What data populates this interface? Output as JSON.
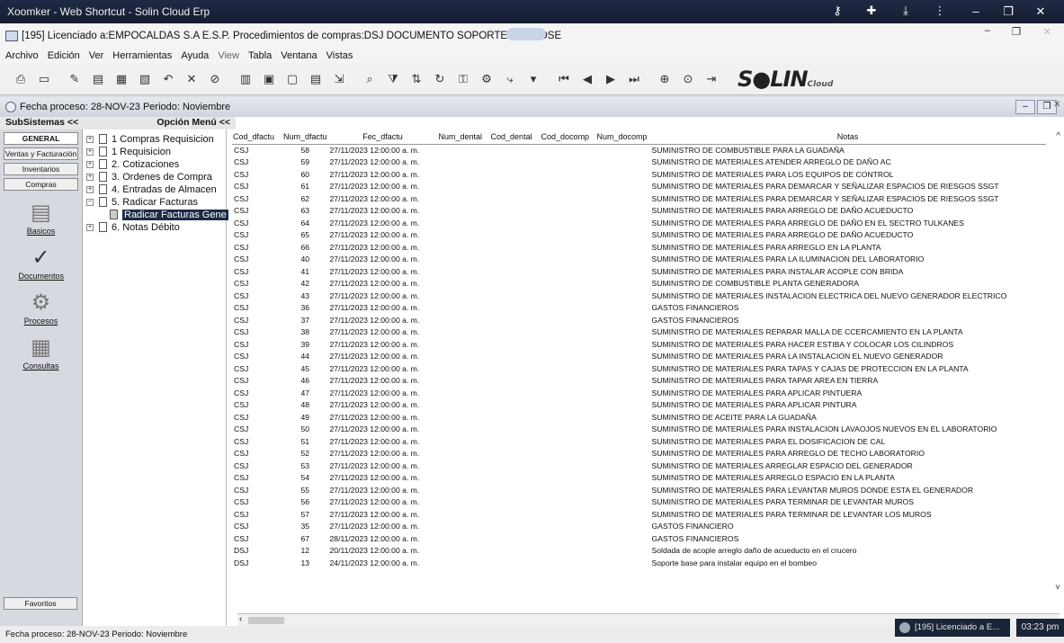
{
  "window": {
    "title": "Xoomker - Web Shortcut - Solin Cloud Erp",
    "doc_title": "[195] Licenciado a:EMPOCALDAS S.A E.S.P. Procedimientos de compras:DSJ DOCUMENTO SOPORTE SAN JOSE"
  },
  "menu": [
    "Archivo",
    "Edición",
    "Ver",
    "Herramientas",
    "Ayuda",
    "View",
    "Tabla",
    "Ventana",
    "Vistas"
  ],
  "logo": {
    "text": "S●LIN",
    "sub": "Cloud"
  },
  "inner": {
    "header": "Fecha proceso: 28-NOV-23 Periodo: Noviembre",
    "subsistemas": "SubSistemas <<",
    "opcion_menu": "Opción Menú <<"
  },
  "modules": {
    "buttons": [
      "GENERAL",
      "Ventas y Facturación",
      "Inventarios",
      "Compras"
    ],
    "icons": [
      "Basicos",
      "Documentos",
      "Procesos",
      "Consultas"
    ],
    "favoritos": "Favoritos"
  },
  "tree": [
    {
      "label": "1 Compras Requisicion"
    },
    {
      "label": "1 Requisicion"
    },
    {
      "label": "2. Cotizaciones"
    },
    {
      "label": "3. Ordenes de Compra"
    },
    {
      "label": "4. Entradas de Almacen"
    },
    {
      "label": "5. Radicar Facturas"
    },
    {
      "label": "Radicar Facturas Gene"
    },
    {
      "label": "6. Notas Débito"
    }
  ],
  "grid": {
    "columns": [
      "Cod_dfactu",
      "Num_dfactu",
      "Fec_dfactu",
      "Num_dental",
      "Cod_dental",
      "Cod_docomp",
      "Num_docomp",
      "Notas"
    ],
    "rows": [
      [
        "CSJ",
        "58",
        "27/11/2023 12:00:00 a. m.",
        "SUMINISTRO DE COMBUSTIBLE PARA LA GUADAÑA"
      ],
      [
        "CSJ",
        "59",
        "27/11/2023 12:00:00 a. m.",
        "SUMINISTRO DE MATERIALES ATENDER ARREGLO DE DAÑO AC"
      ],
      [
        "CSJ",
        "60",
        "27/11/2023 12:00:00 a. m.",
        "SUMINISTRO DE MATERIALES PARA LOS EQUIPOS DE CONTROL"
      ],
      [
        "CSJ",
        "61",
        "27/11/2023 12:00:00 a. m.",
        "SUMINISTRO DE MATERIALES PARA DEMARCAR Y SEÑALIZAR ESPACIOS DE RIESGOS SSGT"
      ],
      [
        "CSJ",
        "62",
        "27/11/2023 12:00:00 a. m.",
        "SUMINISTRO DE MATERIALES PARA DEMARCAR Y SEÑALIZAR ESPACIOS DE RIESGOS SSGT"
      ],
      [
        "CSJ",
        "63",
        "27/11/2023 12:00:00 a. m.",
        "SUMINISTRO DE MATERIALES PARA ARREGLO DE DAÑO ACUEDUCTO"
      ],
      [
        "CSJ",
        "64",
        "27/11/2023 12:00:00 a. m.",
        "SUMINISTRO DE MATERIALES PARA ARREGLO DE DAÑO EN EL SECTRO TULKANES"
      ],
      [
        "CSJ",
        "65",
        "27/11/2023 12:00:00 a. m.",
        "SUMINISTRO DE MATERIALES PARA ARREGLO DE DAÑO ACUEDUCTO"
      ],
      [
        "CSJ",
        "66",
        "27/11/2023 12:00:00 a. m.",
        "SUMINISTRO DE MATERIALES PARA ARREGLO EN LA PLANTA"
      ],
      [
        "CSJ",
        "40",
        "27/11/2023 12:00:00 a. m.",
        "SUMINISTRO DE MATERIALES PARA LA ILUMINACION DEL LABORATORIO"
      ],
      [
        "CSJ",
        "41",
        "27/11/2023 12:00:00 a. m.",
        "SUMINISTRO DE MATERIALES PARA INSTALAR ACOPLE CON BRIDA"
      ],
      [
        "CSJ",
        "42",
        "27/11/2023 12:00:00 a. m.",
        "SUMINISTRO DE COMBUSTIBLE PLANTA GENERADORA"
      ],
      [
        "CSJ",
        "43",
        "27/11/2023 12:00:00 a. m.",
        "SUMINISTRO DE MATERIALES INSTALACION ELECTRICA DEL NUEVO GENERADOR ELECTRICO"
      ],
      [
        "CSJ",
        "36",
        "27/11/2023 12:00:00 a. m.",
        "GASTOS FINANCIEROS"
      ],
      [
        "CSJ",
        "37",
        "27/11/2023 12:00:00 a. m.",
        "GASTOS FINANCIEROS"
      ],
      [
        "CSJ",
        "38",
        "27/11/2023 12:00:00 a. m.",
        "SUMINISTRO DE MATERIALES REPARAR MALLA DE CCERCAMIENTO EN LA PLANTA"
      ],
      [
        "CSJ",
        "39",
        "27/11/2023 12:00:00 a. m.",
        "SUMINISTRO DE MATERIALES PARA HACER ESTIBA Y COLOCAR LOS CILINDROS"
      ],
      [
        "CSJ",
        "44",
        "27/11/2023 12:00:00 a. m.",
        "SUMINISTRO DE MATERIALES PARA LA INSTALACION EL NUEVO GENERADOR"
      ],
      [
        "CSJ",
        "45",
        "27/11/2023 12:00:00 a. m.",
        "SUMINISTRO DE MATERIALES PARA TAPAS Y CAJAS DE PROTECCION EN LA PLANTA"
      ],
      [
        "CSJ",
        "46",
        "27/11/2023 12:00:00 a. m.",
        "SUMINISTRO DE MATERIALES PARA TAPAR AREA EN TIERRA"
      ],
      [
        "CSJ",
        "47",
        "27/11/2023 12:00:00 a. m.",
        "SUMINISTRO DE MATERIALES PARA APLICAR PINTUERA"
      ],
      [
        "CSJ",
        "48",
        "27/11/2023 12:00:00 a. m.",
        "SUMINISTRO DE MATERIALES PARA APLICAR PINTURA"
      ],
      [
        "CSJ",
        "49",
        "27/11/2023 12:00:00 a. m.",
        "SUMINISTRO DE ACEITE PARA LA GUADAÑA"
      ],
      [
        "CSJ",
        "50",
        "27/11/2023 12:00:00 a. m.",
        "SUMINISTRO DE MATERIALES PARA INSTALACION LAVAOJOS NUEVOS EN EL LABORATORIO"
      ],
      [
        "CSJ",
        "51",
        "27/11/2023 12:00:00 a. m.",
        "SUMINISTRO DE MATERIALES PARA EL DOSIFICACION DE CAL"
      ],
      [
        "CSJ",
        "52",
        "27/11/2023 12:00:00 a. m.",
        "SUMINISTRO DE MATERIALES PARA ARREGLO DE TECHO LABORATORIO"
      ],
      [
        "CSJ",
        "53",
        "27/11/2023 12:00:00 a. m.",
        "SUMINISTRO DE MATERIALES ARREGLAR ESPACIO DEL GENERADOR"
      ],
      [
        "CSJ",
        "54",
        "27/11/2023 12:00:00 a. m.",
        "SUMINISTRO DE MATERIALES ARREGLO ESPACIO EN LA PLANTA"
      ],
      [
        "CSJ",
        "55",
        "27/11/2023 12:00:00 a. m.",
        "SUMINISTRO DE MATERIALES PARA LEVANTAR MUROS DONDE ESTA EL GENERADOR"
      ],
      [
        "CSJ",
        "56",
        "27/11/2023 12:00:00 a. m.",
        "SUMINISTRO DE MATERIALES PARA TERMINAR DE LEVANTAR MUROS"
      ],
      [
        "CSJ",
        "57",
        "27/11/2023 12:00:00 a. m.",
        "SUMINISTRO DE MATERIALES PARA TERMINAR DE LEVANTAR LOS MUROS"
      ],
      [
        "CSJ",
        "35",
        "27/11/2023 12:00:00 a. m.",
        "GASTOS FINANCIERO"
      ],
      [
        "CSJ",
        "67",
        "28/11/2023 12:00:00 a. m.",
        "GASTOS FINANCIEROS"
      ],
      [
        "DSJ",
        "12",
        "20/11/2023 12:00:00 a. m.",
        "Soldada de acople arreglo daño de acueducto en el crucero"
      ],
      [
        "DSJ",
        "13",
        "24/11/2023 12:00:00 a. m.",
        "Soporte base para instalar equipo en el bombeo"
      ]
    ]
  },
  "status": {
    "text": "Fecha proceso: 28-NOV-23 Periodo: Noviembre",
    "task": "[195] Licenciado a E...",
    "clock": "03:23 pm"
  }
}
